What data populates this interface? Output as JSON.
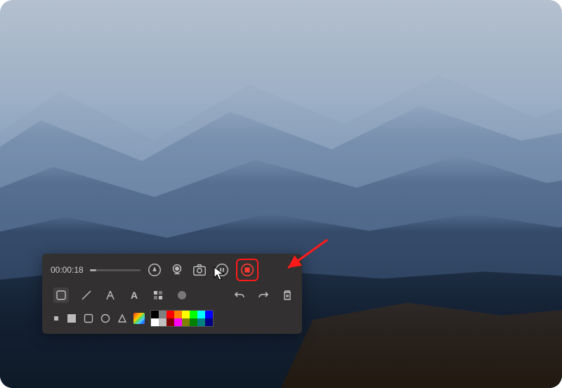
{
  "recording": {
    "timer": "00:00:18"
  },
  "controls": {
    "mic_icon": "mic-icon",
    "webcam_icon": "webcam-icon",
    "screenshot_icon": "screenshot-icon",
    "pause_icon": "pause-icon",
    "stop_icon": "stop-icon"
  },
  "tools": {
    "rect_label": "rectangle",
    "line_label": "line",
    "arrow_label": "arrow",
    "text_label": "A",
    "blur_label": "blur",
    "brush_label": "brush",
    "undo_label": "undo",
    "redo_label": "redo",
    "trash_label": "trash"
  },
  "shapes": {
    "filled_square": "filled-square",
    "filled_square_2": "filled-square",
    "outlined_square": "outlined-square",
    "circle": "circle",
    "triangle": "triangle"
  },
  "colors": {
    "swatches": [
      "#000000",
      "#7f7f7f",
      "#ff0000",
      "#ff8000",
      "#ffff00",
      "#00ff00",
      "#00ffff",
      "#0000ff",
      "#ffffff",
      "#bfbfbf",
      "#800000",
      "#ff00ff",
      "#808000",
      "#008000",
      "#008080",
      "#000080"
    ]
  },
  "annotation": {
    "highlight_color": "#ff1a1a"
  }
}
